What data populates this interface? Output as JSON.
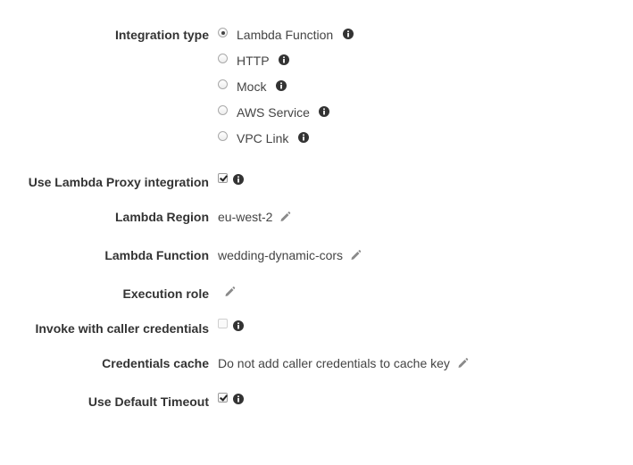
{
  "integration_type": {
    "label": "Integration type",
    "options": [
      {
        "label": "Lambda Function",
        "selected": true
      },
      {
        "label": "HTTP",
        "selected": false
      },
      {
        "label": "Mock",
        "selected": false
      },
      {
        "label": "AWS Service",
        "selected": false
      },
      {
        "label": "VPC Link",
        "selected": false
      }
    ]
  },
  "proxy": {
    "label": "Use Lambda Proxy integration",
    "checked": true
  },
  "region": {
    "label": "Lambda Region",
    "value": "eu-west-2"
  },
  "function": {
    "label": "Lambda Function",
    "value": "wedding-dynamic-cors"
  },
  "role": {
    "label": "Execution role",
    "value": ""
  },
  "invoke": {
    "label": "Invoke with caller credentials",
    "checked": false
  },
  "cache": {
    "label": "Credentials cache",
    "value": "Do not add caller credentials to cache key"
  },
  "timeout": {
    "label": "Use Default Timeout",
    "checked": true
  },
  "colors": {
    "text": "#444444",
    "label": "#333333",
    "icon": "#333333",
    "pencil": "#888888"
  }
}
